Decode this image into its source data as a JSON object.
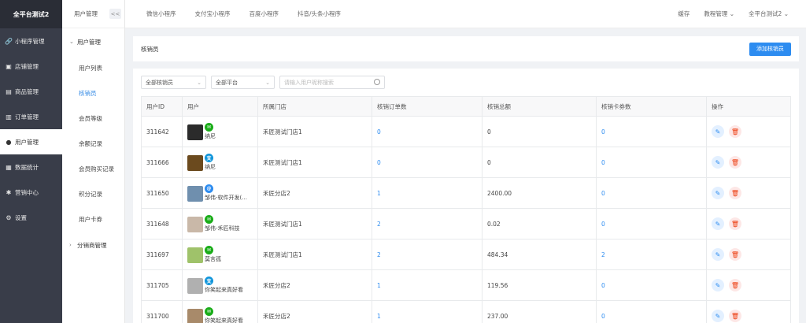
{
  "sidebar": {
    "title": "全平台测试2",
    "items": [
      {
        "label": "小程序管理",
        "icon": "link-icon",
        "glyph": "🔗"
      },
      {
        "label": "店铺管理",
        "icon": "shop-icon",
        "glyph": "▣"
      },
      {
        "label": "商品管理",
        "icon": "goods-icon",
        "glyph": "▤"
      },
      {
        "label": "订单管理",
        "icon": "order-icon",
        "glyph": "▥"
      },
      {
        "label": "用户管理",
        "icon": "user-icon",
        "glyph": "●"
      },
      {
        "label": "数据统计",
        "icon": "chart-icon",
        "glyph": "▦"
      },
      {
        "label": "营销中心",
        "icon": "marketing-icon",
        "glyph": "✱"
      },
      {
        "label": "设置",
        "icon": "settings-icon",
        "glyph": "⚙"
      }
    ]
  },
  "submenu": {
    "header": "用户管理",
    "collapse": "<<",
    "group": "用户管理",
    "items": [
      "用户列表",
      "核销员",
      "会员等级",
      "余额记录",
      "会员购买记录",
      "积分记录",
      "用户卡券"
    ],
    "group2": "分销商管理"
  },
  "topbar": {
    "tabs": [
      "微信小程序",
      "支付宝小程序",
      "百度小程序",
      "抖音/头条小程序"
    ],
    "right": [
      "缓存",
      "教程管理",
      "全平台测试2"
    ]
  },
  "card": {
    "title": "核销员",
    "add_button": "添加核销员"
  },
  "filters": {
    "verifier": "全部核销员",
    "platform": "全部平台",
    "search_placeholder": "请输入用户昵称搜索"
  },
  "table": {
    "columns": [
      "用户ID",
      "用户",
      "所属门店",
      "核销订单数",
      "核销总额",
      "核销卡券数",
      "操作"
    ],
    "rows": [
      {
        "id": "311642",
        "name": "纳尼",
        "platform": "wechat",
        "store": "禾匠测试门店1",
        "orders": "0",
        "total": "0",
        "coupons": "0",
        "avatar": "#2b2b2b"
      },
      {
        "id": "311666",
        "name": "纳尼",
        "platform": "alipay",
        "store": "禾匠测试门店1",
        "orders": "0",
        "total": "0",
        "coupons": "0",
        "avatar": "#6b4a1e"
      },
      {
        "id": "311650",
        "name": "邹伟-软件开发(...",
        "platform": "baidu",
        "store": "禾匠分店2",
        "orders": "1",
        "total": "2400.00",
        "coupons": "0",
        "avatar": "#6f8fae"
      },
      {
        "id": "311648",
        "name": "邹伟-禾匠科技",
        "platform": "wechat",
        "store": "禾匠测试门店1",
        "orders": "2",
        "total": "0.02",
        "coupons": "0",
        "avatar": "#c9b8a8"
      },
      {
        "id": "311697",
        "name": "莫言孤",
        "platform": "wechat",
        "store": "禾匠测试门店1",
        "orders": "2",
        "total": "484.34",
        "coupons": "2",
        "avatar": "#9fc26a"
      },
      {
        "id": "311705",
        "name": "你笑起来真好看",
        "platform": "alipay",
        "store": "禾匠分店2",
        "orders": "1",
        "total": "119.56",
        "coupons": "0",
        "avatar": "#b0b0b0"
      },
      {
        "id": "311700",
        "name": "你笑起来真好看",
        "platform": "wechat",
        "store": "禾匠分店2",
        "orders": "1",
        "total": "237.00",
        "coupons": "0",
        "avatar": "#a88a6a"
      }
    ]
  },
  "platform_colors": {
    "wechat": "#1aad19",
    "alipay": "#1296db",
    "baidu": "#2d8cf0"
  },
  "platform_glyphs": {
    "wechat": "✉",
    "alipay": "支",
    "baidu": "@"
  },
  "colors": {
    "primary": "#2d8cf0",
    "danger": "#ed4014",
    "sidebar": "#393d49"
  }
}
